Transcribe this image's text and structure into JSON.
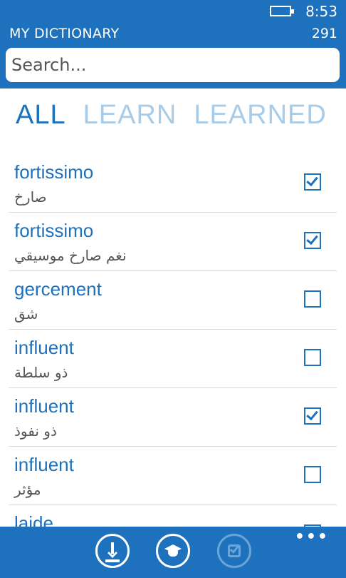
{
  "status_bar": {
    "time": "8:53",
    "battery_icon": "battery-charging-icon"
  },
  "header": {
    "title": "MY DICTIONARY",
    "count": "291"
  },
  "search": {
    "placeholder": "Search...",
    "value": ""
  },
  "tabs": [
    {
      "label": "ALL",
      "active": true
    },
    {
      "label": "LEARN",
      "active": false
    },
    {
      "label": "LEARNED",
      "active": false
    }
  ],
  "entries": [
    {
      "word": "fortissimo",
      "translation": "صارخ",
      "learned": true
    },
    {
      "word": "fortissimo",
      "translation": "نغم صارخ موسيقي",
      "learned": true
    },
    {
      "word": "gercement",
      "translation": "شق",
      "learned": false
    },
    {
      "word": "influent",
      "translation": "ذو سلطة",
      "learned": false
    },
    {
      "word": "influent",
      "translation": "ذو نفوذ",
      "learned": true
    },
    {
      "word": "influent",
      "translation": "مؤثر",
      "learned": false
    },
    {
      "word": "laide",
      "translation": "",
      "learned": true
    }
  ],
  "app_bar": {
    "buttons": [
      {
        "icon": "download-icon",
        "enabled": true
      },
      {
        "icon": "graduation-cap-icon",
        "enabled": true
      },
      {
        "icon": "checkbox-icon",
        "enabled": false
      }
    ],
    "more": "•••"
  },
  "colors": {
    "accent": "#1d71bd",
    "tab_inactive": "#a8cce8",
    "translation_text": "#555555"
  }
}
